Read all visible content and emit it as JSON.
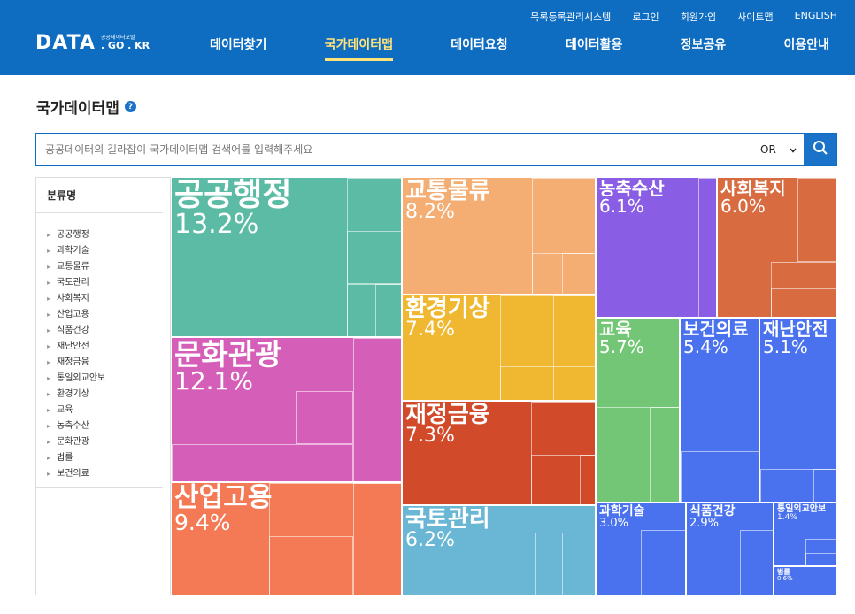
{
  "header": {
    "util_links": [
      "목록등록관리시스템",
      "로그인",
      "회원가입",
      "사이트맵",
      "ENGLISH"
    ],
    "logo_main": "DATA",
    "logo_sub_top": "공공데이터포털",
    "logo_sub_bottom": ". GO . KR",
    "nav": [
      "데이터찾기",
      "국가데이터맵",
      "데이터요청",
      "데이터활용",
      "정보공유",
      "이용안내"
    ],
    "active_nav": "국가데이터맵"
  },
  "page": {
    "title": "국가데이터맵",
    "help_glyph": "?"
  },
  "search": {
    "placeholder": "공공데이터의 길라잡이 국가데이터맵 검색어를 입력해주세요",
    "value": "",
    "operator": "OR"
  },
  "sidebar": {
    "heading": "분류명",
    "items": [
      "공공행정",
      "과학기술",
      "교통물류",
      "국토관리",
      "사회복지",
      "산업고용",
      "식품건강",
      "재난안전",
      "재정금융",
      "통일외교안보",
      "환경기상",
      "교육",
      "농축수산",
      "문화관광",
      "법률",
      "보건의료"
    ]
  },
  "treemap": {
    "tiles": [
      {
        "name": "공공행정",
        "pct": "13.2%",
        "color": "#5cbba5"
      },
      {
        "name": "문화관광",
        "pct": "12.1%",
        "color": "#d55fb8"
      },
      {
        "name": "산업고용",
        "pct": "9.4%",
        "color": "#f47a56"
      },
      {
        "name": "교통물류",
        "pct": "8.2%",
        "color": "#f4ad73"
      },
      {
        "name": "환경기상",
        "pct": "7.4%",
        "color": "#f0b730"
      },
      {
        "name": "재정금융",
        "pct": "7.3%",
        "color": "#d14a2a"
      },
      {
        "name": "국토관리",
        "pct": "6.2%",
        "color": "#69b7d4"
      },
      {
        "name": "농축수산",
        "pct": "6.1%",
        "color": "#8a5ee4"
      },
      {
        "name": "사회복지",
        "pct": "6.0%",
        "color": "#d86c40"
      },
      {
        "name": "교육",
        "pct": "5.7%",
        "color": "#72c675"
      },
      {
        "name": "보건의료",
        "pct": "5.4%",
        "color": "#4a72ef"
      },
      {
        "name": "재난안전",
        "pct": "5.1%",
        "color": "#4a72ef"
      },
      {
        "name": "과학기술",
        "pct": "3.0%",
        "color": "#4a72ef"
      },
      {
        "name": "식품건강",
        "pct": "2.9%",
        "color": "#4a72ef"
      },
      {
        "name": "통일외교안보",
        "pct": "1.4%",
        "color": "#4a72ef"
      },
      {
        "name": "법률",
        "pct": "0.6%",
        "color": "#4a72ef"
      }
    ]
  }
}
